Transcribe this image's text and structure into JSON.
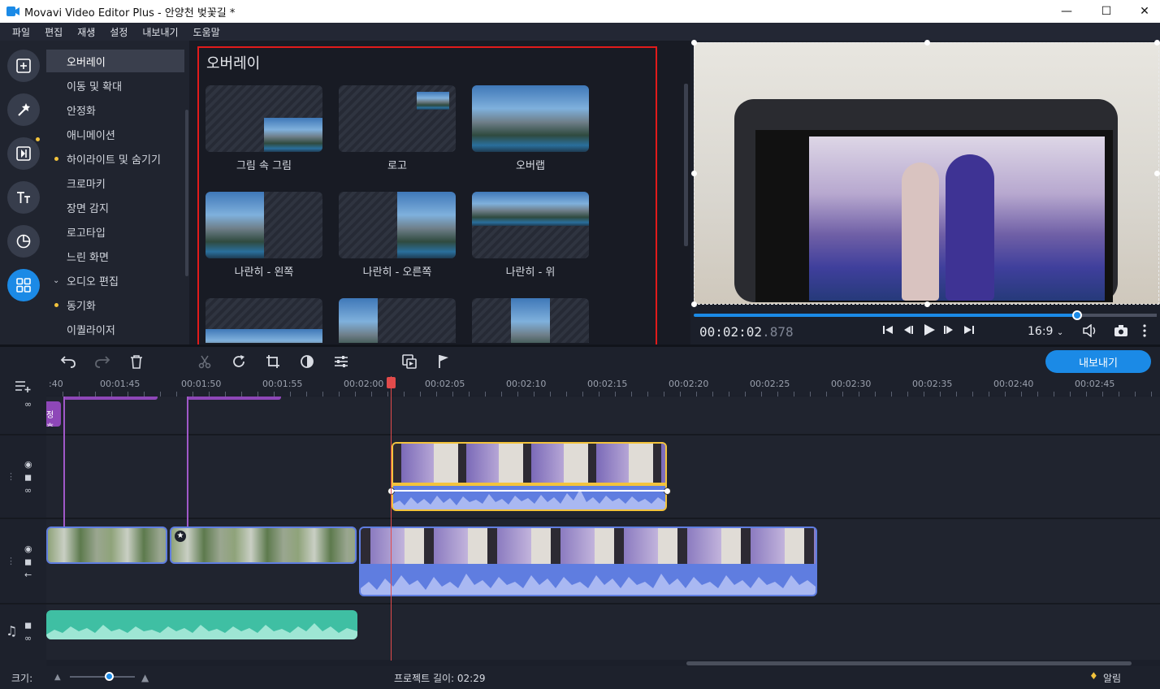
{
  "window": {
    "title": "Movavi Video Editor Plus - 안양천 벚꽃길 *",
    "minimize": "—",
    "maximize": "☐",
    "close": "✕"
  },
  "menu": [
    "파일",
    "편집",
    "재생",
    "설정",
    "내보내기",
    "도움말"
  ],
  "tools": {
    "items": [
      {
        "label": "오버레이",
        "active": true
      },
      {
        "label": "이동 및 확대"
      },
      {
        "label": "안정화"
      },
      {
        "label": "애니메이션"
      },
      {
        "label": "하이라이트 및 숨기기",
        "dot": true
      },
      {
        "label": "크로마키"
      },
      {
        "label": "장면 감지"
      },
      {
        "label": "로고타입"
      },
      {
        "label": "느린 화면"
      },
      {
        "label": "오디오 편집",
        "chevron": true
      },
      {
        "label": "동기화",
        "dot": true
      },
      {
        "label": "이퀄라이저"
      }
    ]
  },
  "overlay_panel": {
    "title": "오버레이",
    "thumbs": [
      "그림 속 그림",
      "로고",
      "오버랩",
      "나란히 - 왼쪽",
      "나란히 - 오른쪽",
      "나란히 - 위"
    ]
  },
  "player": {
    "time_main": "00:02:02",
    "time_ms": ".878",
    "ratio": "16:9",
    "progress": 0.82
  },
  "timeline": {
    "export_label": "내보내기",
    "ticks": [
      ":40",
      "00:01:45",
      "00:01:50",
      "00:01:55",
      "00:02:00",
      "00:02:05",
      "00:02:10",
      "00:02:15",
      "00:02:20",
      "00:02:25",
      "00:02:30",
      "00:02:35",
      "00:02:40",
      "00:02:45"
    ],
    "title_clip_label": "정호"
  },
  "status": {
    "size_label": "크기:",
    "project_length": "프로젝트 길이: 02:29",
    "notifications": "알림"
  },
  "colors": {
    "accent": "#1b8ae6",
    "highlight_frame": "#e11b1b",
    "selected_clip": "#f3c33c",
    "audio_track": "#5f7de0",
    "music_clip": "#3fbfa3"
  }
}
